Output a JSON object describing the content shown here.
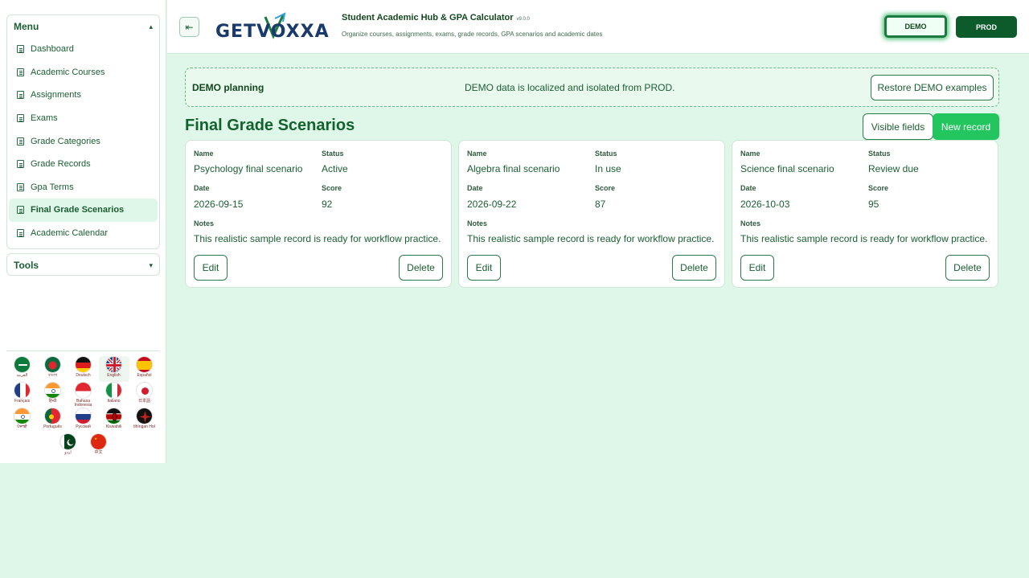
{
  "sidebar": {
    "menu_title": "Menu",
    "tools_title": "Tools",
    "items": [
      {
        "label": "Dashboard",
        "active": false
      },
      {
        "label": "Academic Courses",
        "active": false
      },
      {
        "label": "Assignments",
        "active": false
      },
      {
        "label": "Exams",
        "active": false
      },
      {
        "label": "Grade Categories",
        "active": false
      },
      {
        "label": "Grade Records",
        "active": false
      },
      {
        "label": "Gpa Terms",
        "active": false
      },
      {
        "label": "Final Grade Scenarios",
        "active": true
      },
      {
        "label": "Academic Calendar",
        "active": false
      }
    ],
    "languages": [
      {
        "label": "العربية",
        "flag": "sa"
      },
      {
        "label": "বাংলা",
        "flag": "bd"
      },
      {
        "label": "Deutsch",
        "flag": "de"
      },
      {
        "label": "English",
        "flag": "gb",
        "selected": true
      },
      {
        "label": "Español",
        "flag": "es"
      },
      {
        "label": "Français",
        "flag": "fr"
      },
      {
        "label": "हिन्दी",
        "flag": "in"
      },
      {
        "label": "Bahasa Indonesia",
        "flag": "id"
      },
      {
        "label": "Italiano",
        "flag": "it"
      },
      {
        "label": "日本語",
        "flag": "jp"
      },
      {
        "label": "ਪੰਜਾਬੀ",
        "flag": "in"
      },
      {
        "label": "Português",
        "flag": "pt"
      },
      {
        "label": "Русский",
        "flag": "ru"
      },
      {
        "label": "Kiswahili",
        "flag": "ke"
      },
      {
        "label": "tlhIngan Hol",
        "flag": "kl"
      },
      {
        "label": "اردو",
        "flag": "pk"
      },
      {
        "label": "中文",
        "flag": "cn"
      }
    ]
  },
  "header": {
    "logo_text": "GETVOXXA",
    "title": "Student Academic Hub & GPA Calculator",
    "version": "v9.0.0",
    "subtitle": "Organize courses, assignments, exams, grade records, GPA scenarios and academic dates",
    "demo_label": "DEMO",
    "prod_label": "PROD"
  },
  "banner": {
    "title": "DEMO planning",
    "message": "DEMO data is localized and isolated from PROD.",
    "restore_label": "Restore DEMO examples"
  },
  "section": {
    "title": "Final Grade Scenarios",
    "visible_fields_label": "Visible fields",
    "new_record_label": "New record"
  },
  "field_labels": {
    "name": "Name",
    "status": "Status",
    "date": "Date",
    "score": "Score",
    "notes": "Notes",
    "edit": "Edit",
    "delete": "Delete"
  },
  "records": [
    {
      "name": "Psychology final scenario",
      "status": "Active",
      "date": "2026-09-15",
      "score": "92",
      "notes": "This realistic sample record is ready for workflow practice."
    },
    {
      "name": "Algebra final scenario",
      "status": "In use",
      "date": "2026-09-22",
      "score": "87",
      "notes": "This realistic sample record is ready for workflow practice."
    },
    {
      "name": "Science final scenario",
      "status": "Review due",
      "date": "2026-10-03",
      "score": "95",
      "notes": "This realistic sample record is ready for workflow practice."
    }
  ],
  "colors": {
    "accent": "#22c55e",
    "brand_dark": "#0d5a2b",
    "background": "#dff7e8"
  }
}
